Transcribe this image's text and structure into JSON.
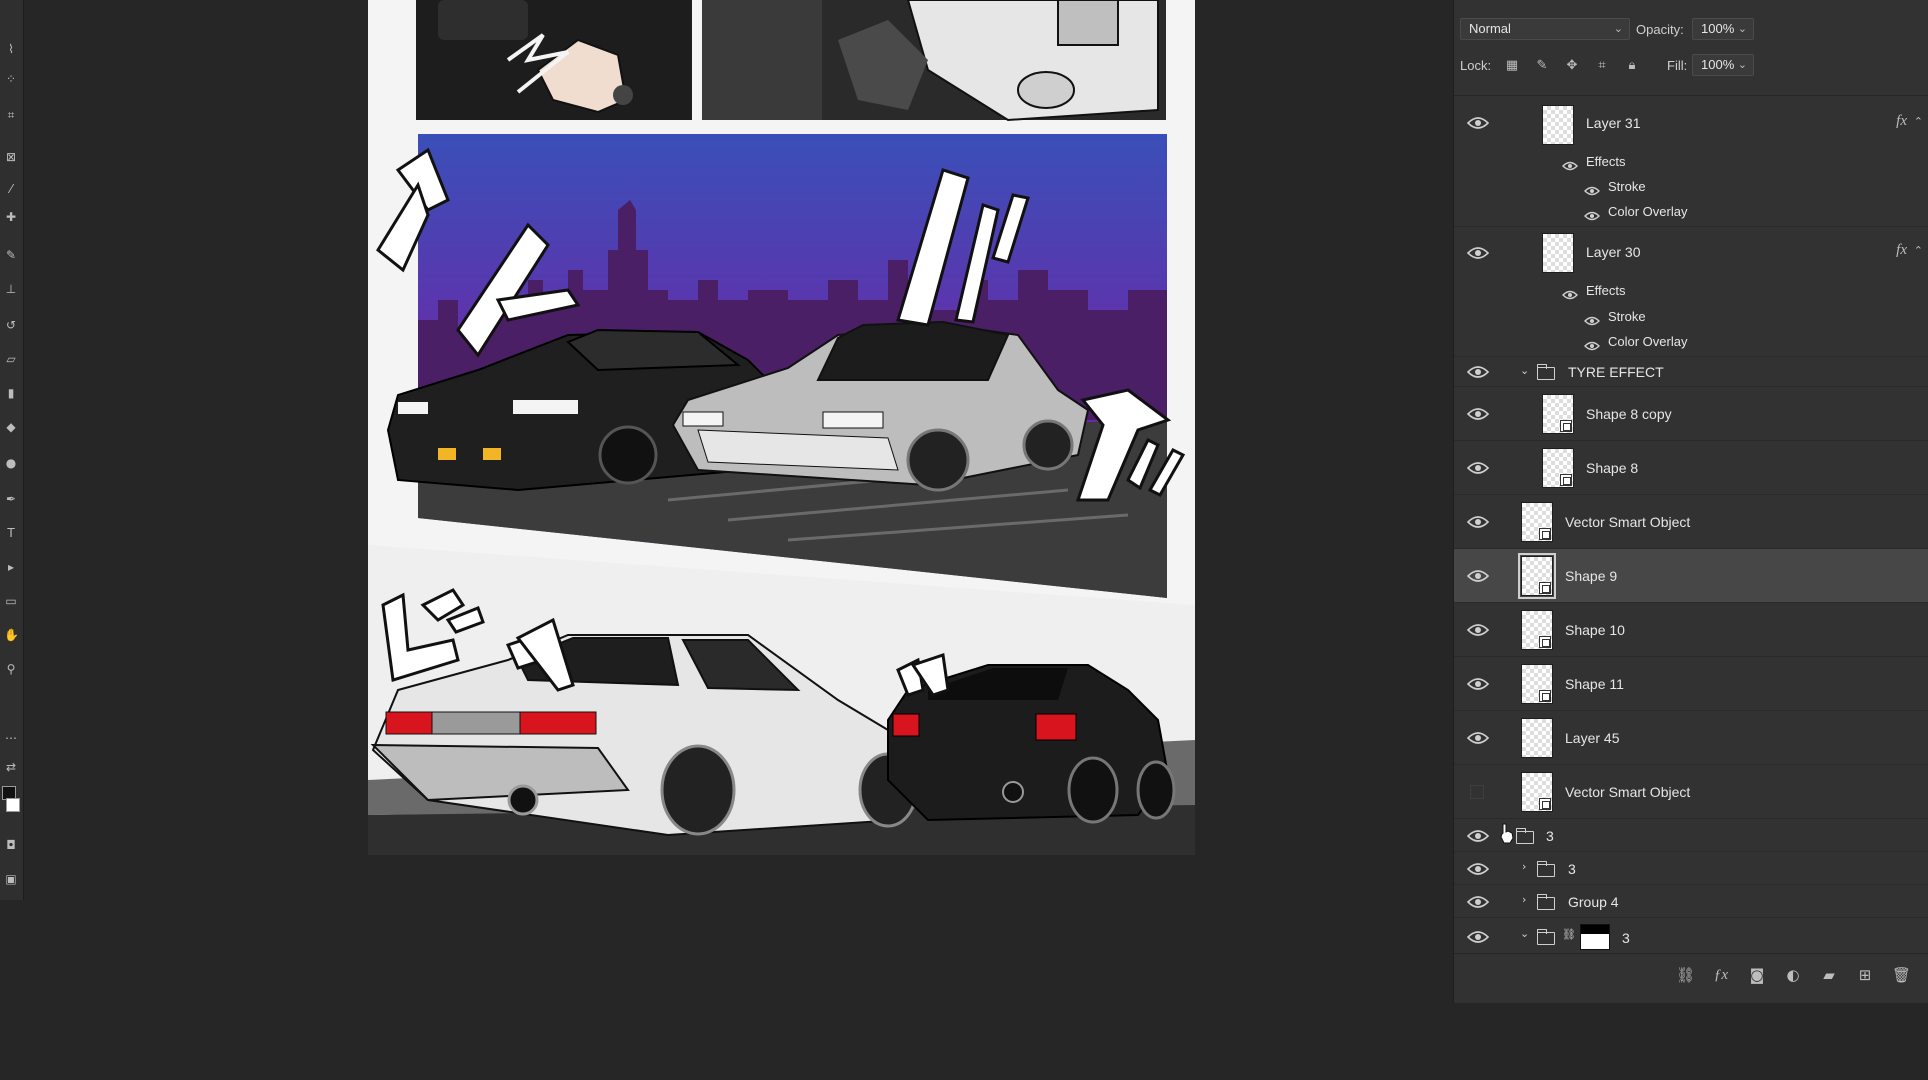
{
  "blend_mode": {
    "value": "Normal"
  },
  "opacity": {
    "label": "Opacity:",
    "value": "100%"
  },
  "lock": {
    "label": "Lock:"
  },
  "fill": {
    "label": "Fill:",
    "value": "100%"
  },
  "layers": [
    {
      "name": "Layer 31",
      "fx": "fx",
      "effects_label": "Effects",
      "effects": [
        "Stroke",
        "Color Overlay"
      ]
    },
    {
      "name": "Layer 30",
      "fx": "fx",
      "effects_label": "Effects",
      "effects": [
        "Stroke",
        "Color Overlay"
      ]
    },
    {
      "name": "TYRE EFFECT"
    },
    {
      "name": "Shape 8 copy"
    },
    {
      "name": "Shape 8"
    },
    {
      "name": "Vector Smart Object"
    },
    {
      "name": "Shape 9",
      "selected": true
    },
    {
      "name": "Shape 10"
    },
    {
      "name": "Shape 11"
    },
    {
      "name": "Layer 45"
    },
    {
      "name": "Vector Smart Object",
      "visible": false
    },
    {
      "name": "3"
    },
    {
      "name": "3"
    },
    {
      "name": "Group 4"
    },
    {
      "name": "3"
    }
  ],
  "artwork": {
    "sfx_1": "ジュ",
    "sfx_2": "ッ",
    "sfx_3": "ア",
    "sfx_4": "ヒュ",
    "sfx_5": "ッ",
    "sfx_6": "ッ",
    "colors": {
      "sky_top": "#3a4fb8",
      "sky_bottom": "#7a1f9a",
      "taillight": "#d8141e",
      "headlight": "#f2b526"
    }
  }
}
